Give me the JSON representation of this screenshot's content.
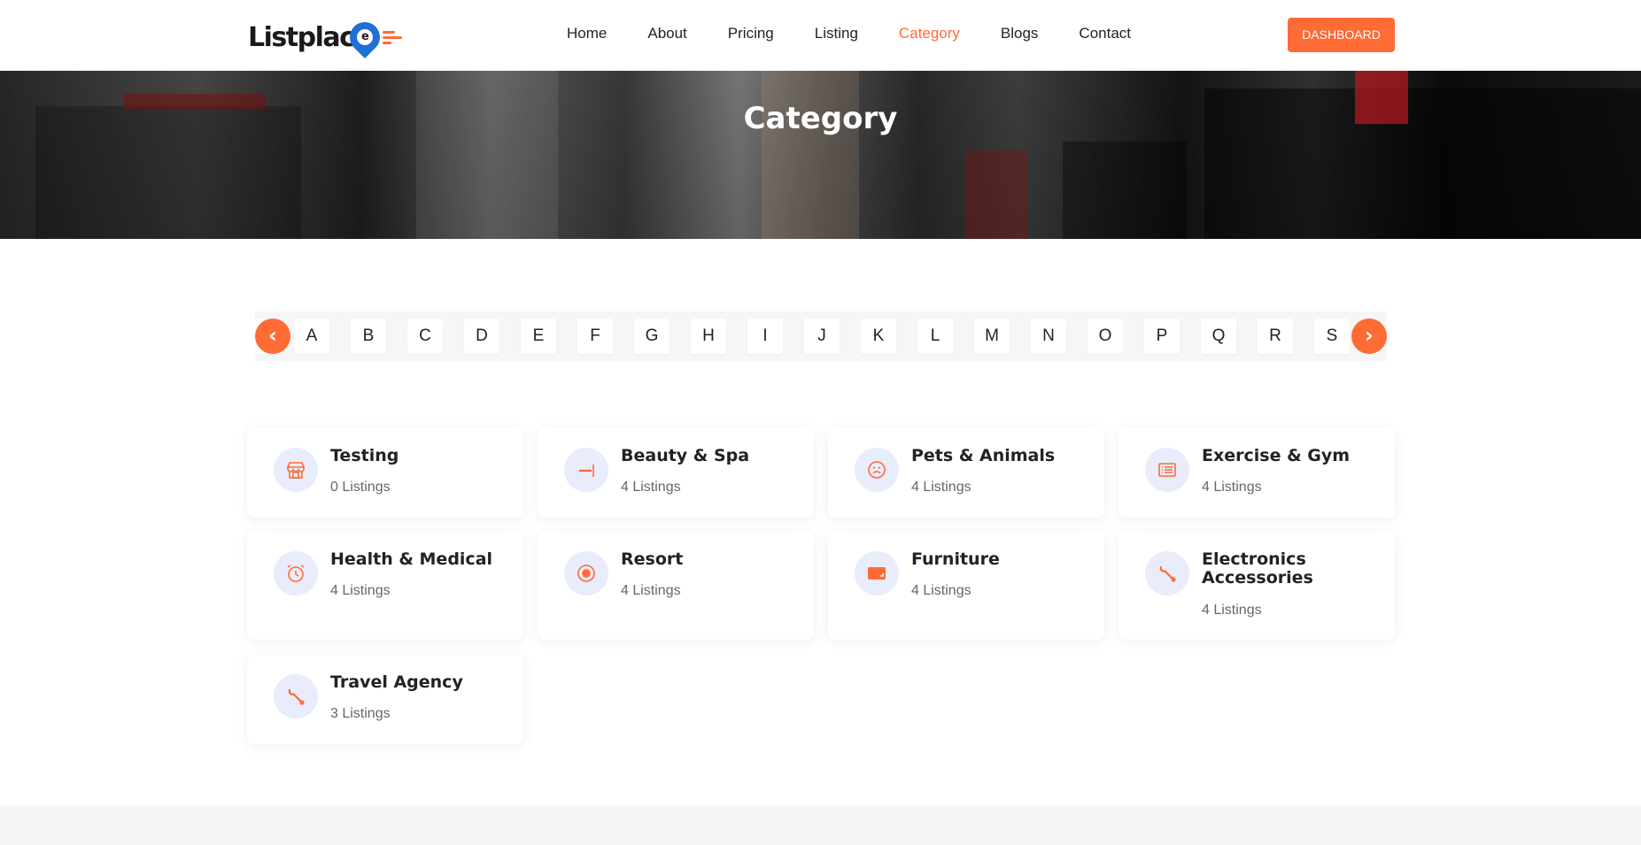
{
  "brand": {
    "name": "Listplac",
    "pin_letter": "e",
    "accent": "#ff6b35"
  },
  "nav": {
    "items": [
      {
        "label": "Home",
        "active": false
      },
      {
        "label": "About",
        "active": false
      },
      {
        "label": "Pricing",
        "active": false
      },
      {
        "label": "Listing",
        "active": false
      },
      {
        "label": "Category",
        "active": true
      },
      {
        "label": "Blogs",
        "active": false
      },
      {
        "label": "Contact",
        "active": false
      }
    ],
    "dashboard_label": "DASHBOARD"
  },
  "hero": {
    "title": "Category"
  },
  "alphabet": {
    "prev_label": "‹",
    "next_label": "›",
    "letters": [
      "A",
      "B",
      "C",
      "D",
      "E",
      "F",
      "G",
      "H",
      "I",
      "J",
      "K",
      "L",
      "M",
      "N",
      "O",
      "P",
      "Q",
      "R",
      "S"
    ]
  },
  "categories": [
    {
      "name": "Testing",
      "count": "0 Listings",
      "icon": "store-icon"
    },
    {
      "name": "Beauty & Spa",
      "count": "4 Listings",
      "icon": "dash-icon"
    },
    {
      "name": "Pets & Animals",
      "count": "4 Listings",
      "icon": "frown-icon"
    },
    {
      "name": "Exercise & Gym",
      "count": "4 Listings",
      "icon": "list-icon"
    },
    {
      "name": "Health & Medical",
      "count": "4 Listings",
      "icon": "alarm-clock-icon"
    },
    {
      "name": "Resort",
      "count": "4 Listings",
      "icon": "record-icon"
    },
    {
      "name": "Furniture",
      "count": "4 Listings",
      "icon": "screen-icon"
    },
    {
      "name": "Electronics Accessories",
      "count": "4 Listings",
      "icon": "wrench-icon"
    },
    {
      "name": "Travel Agency",
      "count": "3 Listings",
      "icon": "wrench-icon"
    }
  ]
}
